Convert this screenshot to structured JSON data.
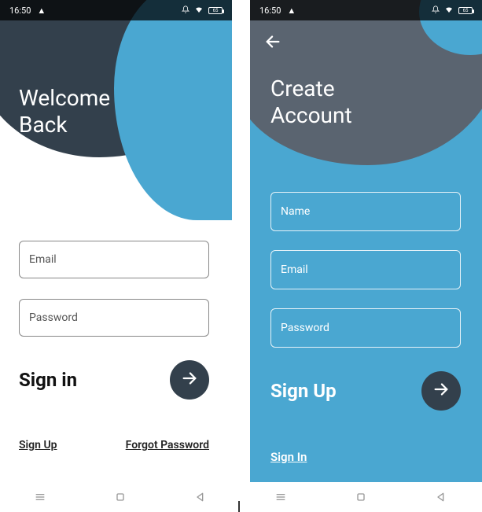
{
  "status": {
    "time": "16:50",
    "battery": "65"
  },
  "screenA": {
    "title_l1": "Welcome",
    "title_l2": "Back",
    "email_ph": "Email",
    "password_ph": "Password",
    "signin_label": "Sign in",
    "signup_link": "Sign Up",
    "forgot_link": "Forgot Password"
  },
  "screenB": {
    "title_l1": "Create",
    "title_l2": "Account",
    "name_ph": "Name",
    "email_ph": "Email",
    "password_ph": "Password",
    "signup_label": "Sign Up",
    "signin_link": "Sign In"
  }
}
